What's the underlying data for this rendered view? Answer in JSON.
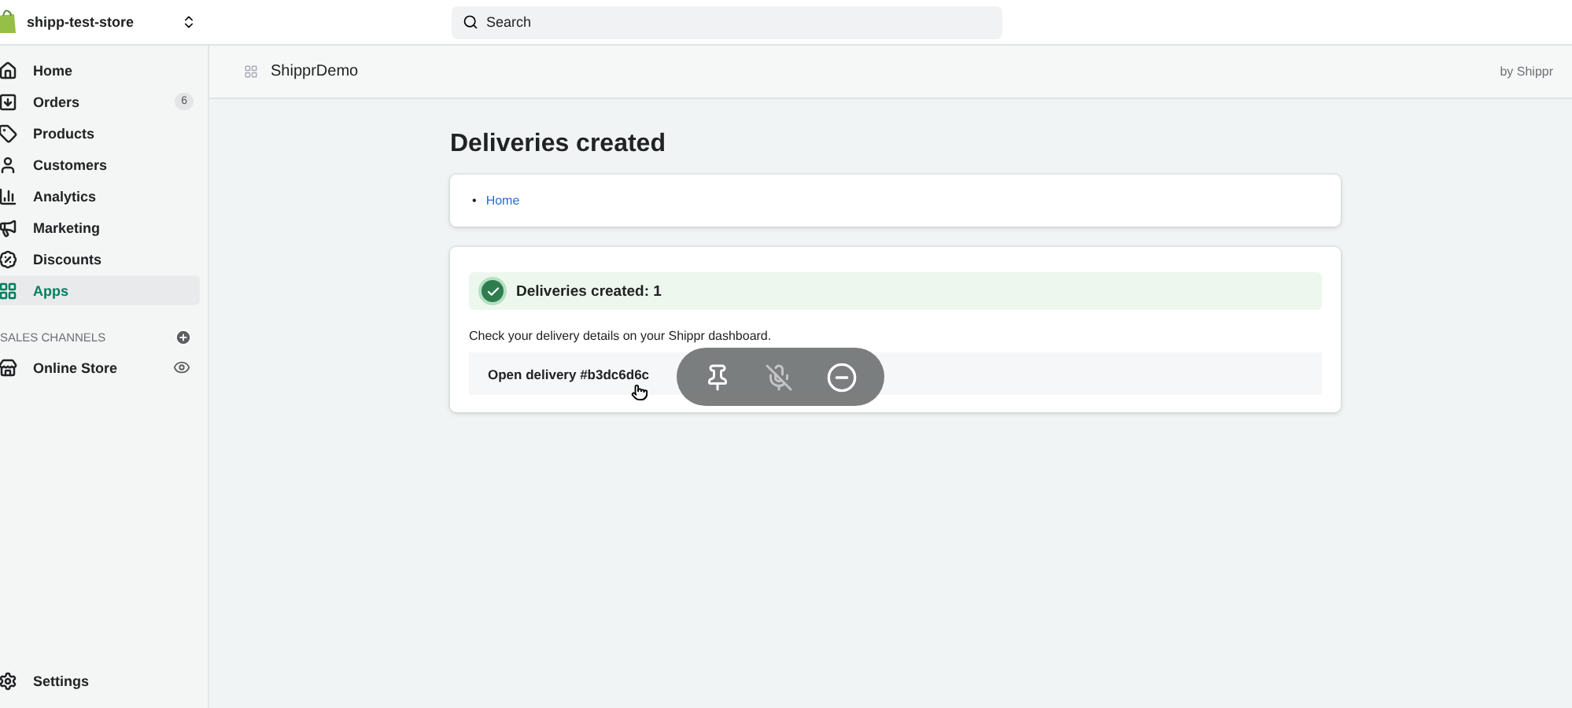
{
  "topbar": {
    "store_name": "shipp-test-store",
    "search": {
      "placeholder": "Search"
    }
  },
  "sidebar": {
    "items": [
      {
        "kind": "home",
        "label": "Home",
        "selected": false
      },
      {
        "kind": "orders",
        "label": "Orders",
        "badge": "6",
        "selected": false
      },
      {
        "kind": "products",
        "label": "Products",
        "selected": false
      },
      {
        "kind": "customers",
        "label": "Customers",
        "selected": false
      },
      {
        "kind": "analytics",
        "label": "Analytics",
        "selected": false
      },
      {
        "kind": "marketing",
        "label": "Marketing",
        "selected": false
      },
      {
        "kind": "discounts",
        "label": "Discounts",
        "selected": false
      },
      {
        "kind": "apps",
        "label": "Apps",
        "selected": true
      }
    ],
    "section_title": "SALES CHANNELS",
    "channels": [
      {
        "kind": "store",
        "label": "Online Store",
        "selected": false
      }
    ],
    "settings": "Settings"
  },
  "app_header": {
    "title": "ShipprDemo",
    "by": "by Shippr"
  },
  "page": {
    "title": "Deliveries created",
    "breadcrumbs": [
      {
        "marker": "•",
        "label": "Home"
      }
    ],
    "banner": {
      "success": true,
      "text": "Deliveries created: 1"
    },
    "message": "Check your delivery details on your Shippr dashboard.",
    "deliveries": [
      "Open delivery #b3dc6d6c"
    ]
  }
}
